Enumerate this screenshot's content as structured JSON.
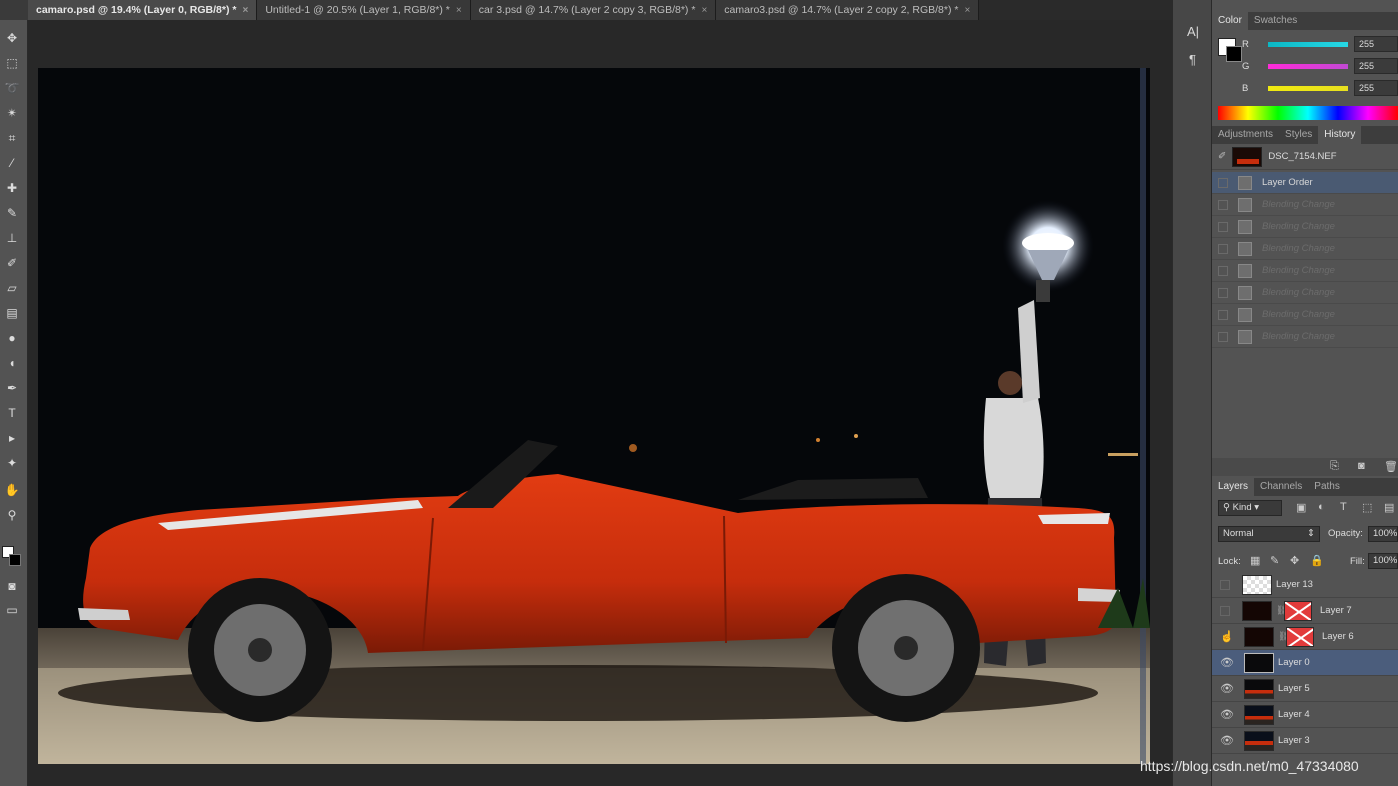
{
  "tabs": [
    {
      "label": "camaro.psd @ 19.4% (Layer 0, RGB/8*) *",
      "active": true
    },
    {
      "label": "Untitled-1 @ 20.5% (Layer 1, RGB/8*) *",
      "active": false
    },
    {
      "label": "car 3.psd @ 14.7% (Layer 2 copy 3, RGB/8*) *",
      "active": false
    },
    {
      "label": "camaro3.psd @ 14.7% (Layer 2 copy 2, RGB/8*) *",
      "active": false
    }
  ],
  "tab_close": "×",
  "side_strip_icons": [
    "A|",
    "¶"
  ],
  "color_panel": {
    "tabs": [
      "Color",
      "Swatches"
    ],
    "channels": [
      {
        "label": "R",
        "value": "255",
        "color": "#27d8e6"
      },
      {
        "label": "G",
        "value": "255",
        "color": "#c24ad4"
      },
      {
        "label": "B",
        "value": "255",
        "color": "#e8e020"
      }
    ]
  },
  "history_panel": {
    "tabs": [
      "Adjustments",
      "Styles",
      "History"
    ],
    "snapshot": "DSC_7154.NEF",
    "items": [
      {
        "label": "Layer Order",
        "selected": true,
        "dim": false
      },
      {
        "label": "Blending Change",
        "selected": false,
        "dim": true
      },
      {
        "label": "Blending Change",
        "selected": false,
        "dim": true
      },
      {
        "label": "Blending Change",
        "selected": false,
        "dim": true
      },
      {
        "label": "Blending Change",
        "selected": false,
        "dim": true
      },
      {
        "label": "Blending Change",
        "selected": false,
        "dim": true
      },
      {
        "label": "Blending Change",
        "selected": false,
        "dim": true
      },
      {
        "label": "Blending Change",
        "selected": false,
        "dim": true
      }
    ]
  },
  "layers_panel": {
    "tabs": [
      "Layers",
      "Channels",
      "Paths"
    ],
    "filter": "Kind",
    "blend_mode": "Normal",
    "opacity_label": "Opacity:",
    "opacity": "100%",
    "lock_label": "Lock:",
    "fill_label": "Fill:",
    "fill": "100%",
    "layers": [
      {
        "name": "Layer 13",
        "visible": false,
        "mask": false,
        "selected": false
      },
      {
        "name": "Layer 7",
        "visible": false,
        "mask": true,
        "selected": false
      },
      {
        "name": "Layer 6",
        "visible": false,
        "mask": true,
        "selected": false
      },
      {
        "name": "Layer 0",
        "visible": true,
        "mask": false,
        "selected": true
      },
      {
        "name": "Layer 5",
        "visible": true,
        "mask": false,
        "selected": false
      },
      {
        "name": "Layer 4",
        "visible": true,
        "mask": false,
        "selected": false
      },
      {
        "name": "Layer 3",
        "visible": true,
        "mask": false,
        "selected": false
      }
    ]
  },
  "watermark": "https://blog.csdn.net/m0_47334080"
}
